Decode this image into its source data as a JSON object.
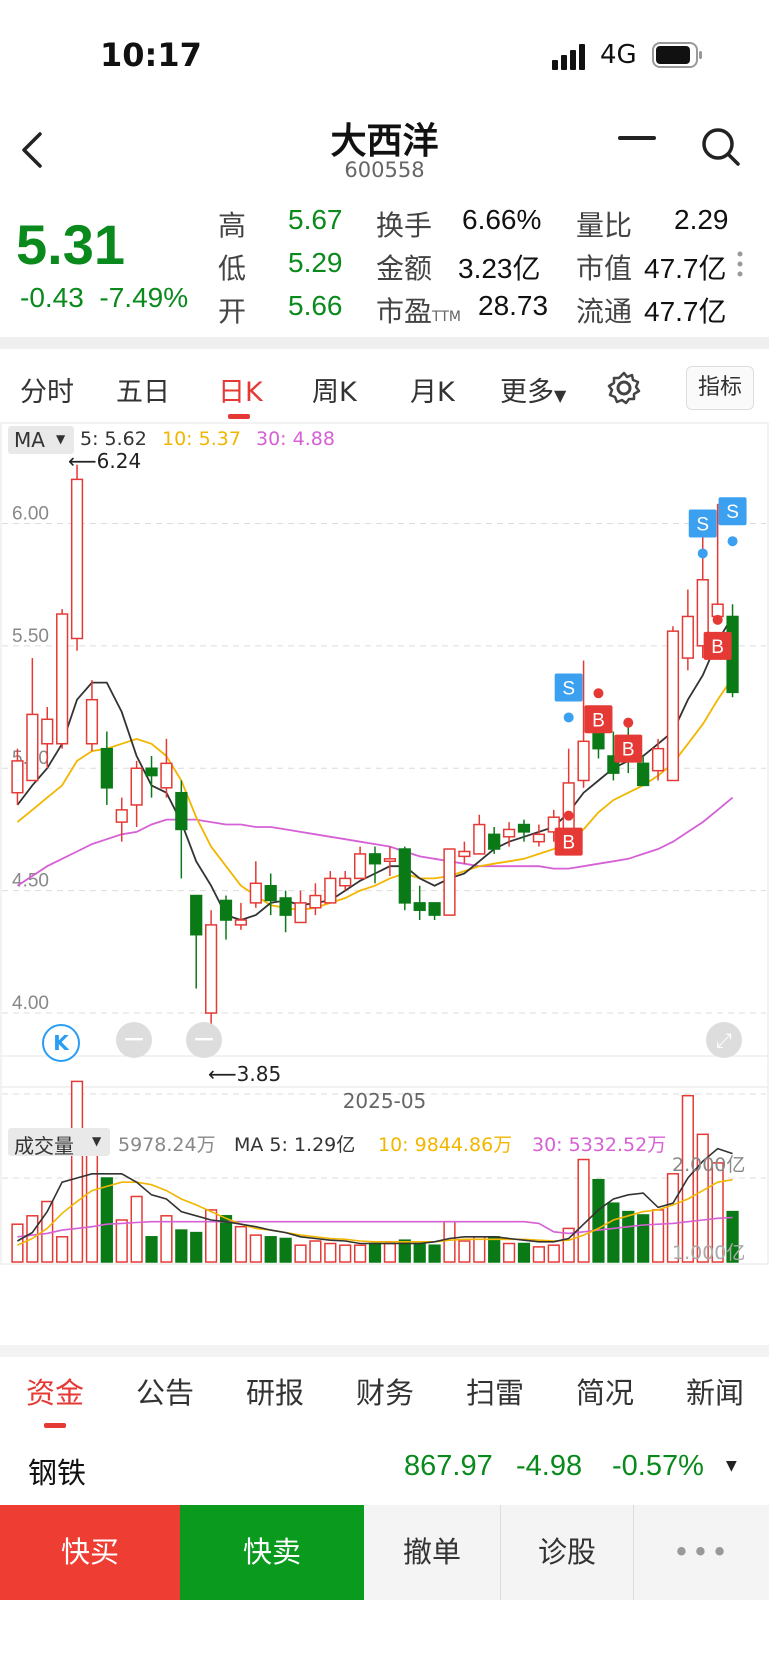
{
  "status_bar": {
    "time": "10:17",
    "network": "4G"
  },
  "header": {
    "title": "大西洋",
    "code": "600558"
  },
  "quote": {
    "price": "5.31",
    "change": "-0.43",
    "change_pct": "-7.49%",
    "high_label": "高",
    "high": "5.67",
    "low_label": "低",
    "low": "5.29",
    "open_label": "开",
    "open": "5.66",
    "turnover_label": "换手",
    "turnover": "6.66%",
    "amount_label": "金额",
    "amount": "3.23亿",
    "pe_label": "市盈",
    "pe_sub": "TTM",
    "pe": "28.73",
    "vol_ratio_label": "量比",
    "vol_ratio": "2.29",
    "mkt_cap_label": "市值",
    "mkt_cap": "47.7亿",
    "float_cap_label": "流通",
    "float_cap": "47.7亿"
  },
  "period_tabs": [
    "分时",
    "五日",
    "日K",
    "周K",
    "月K",
    "更多"
  ],
  "active_period": "日K",
  "indicator_button": "指标",
  "colors": {
    "up": "#e53935",
    "down": "#0a7a17",
    "ma5": "#333333",
    "ma10": "#f2b600",
    "ma30": "#d660d6",
    "sell_marker": "#3ba0f0",
    "buy_marker": "#e53935"
  },
  "chart_data": {
    "type": "candlestick",
    "ylim": [
      3.8,
      6.3
    ],
    "yticks": [
      "6.00",
      "5.50",
      "5.00",
      "4.50",
      "4.00"
    ],
    "ma_label": "MA",
    "ma5_label": "5: 5.62",
    "ma10_label": "10: 5.37",
    "ma30_label": "30: 4.88",
    "max_label": "6.24",
    "min_label": "3.85",
    "date_label": "2025-05",
    "candles": [
      [
        4.9,
        5.03,
        4.85,
        5.08
      ],
      [
        4.95,
        5.22,
        4.95,
        5.45
      ],
      [
        5.1,
        5.2,
        5.0,
        5.25
      ],
      [
        5.1,
        5.63,
        5.08,
        5.65
      ],
      [
        5.53,
        6.18,
        5.48,
        6.24
      ],
      [
        5.1,
        5.28,
        5.07,
        5.36
      ],
      [
        5.08,
        4.92,
        4.85,
        5.15
      ],
      [
        4.78,
        4.83,
        4.7,
        4.88
      ],
      [
        4.85,
        5.0,
        4.76,
        5.03
      ],
      [
        5.0,
        4.97,
        4.88,
        5.05
      ],
      [
        4.92,
        5.02,
        4.88,
        5.12
      ],
      [
        4.9,
        4.75,
        4.55,
        4.95
      ],
      [
        4.48,
        4.32,
        4.1,
        4.48
      ],
      [
        4.0,
        4.36,
        3.85,
        4.42
      ],
      [
        4.46,
        4.38,
        4.3,
        4.48
      ],
      [
        4.36,
        4.38,
        4.34,
        4.45
      ],
      [
        4.45,
        4.53,
        4.43,
        4.62
      ],
      [
        4.52,
        4.46,
        4.4,
        4.57
      ],
      [
        4.47,
        4.4,
        4.33,
        4.5
      ],
      [
        4.37,
        4.45,
        4.37,
        4.5
      ],
      [
        4.43,
        4.48,
        4.4,
        4.53
      ],
      [
        4.45,
        4.55,
        4.45,
        4.58
      ],
      [
        4.52,
        4.55,
        4.5,
        4.58
      ],
      [
        4.55,
        4.65,
        4.55,
        4.68
      ],
      [
        4.65,
        4.61,
        4.53,
        4.68
      ],
      [
        4.62,
        4.63,
        4.56,
        4.68
      ],
      [
        4.67,
        4.45,
        4.42,
        4.68
      ],
      [
        4.45,
        4.42,
        4.38,
        4.52
      ],
      [
        4.45,
        4.4,
        4.38,
        4.45
      ],
      [
        4.4,
        4.67,
        4.4,
        4.67
      ],
      [
        4.64,
        4.66,
        4.61,
        4.7
      ],
      [
        4.65,
        4.77,
        4.65,
        4.81
      ],
      [
        4.73,
        4.67,
        4.65,
        4.76
      ],
      [
        4.72,
        4.75,
        4.68,
        4.78
      ],
      [
        4.77,
        4.74,
        4.7,
        4.79
      ],
      [
        4.7,
        4.73,
        4.68,
        4.77
      ],
      [
        4.74,
        4.8,
        4.7,
        4.83
      ],
      [
        4.75,
        4.94,
        4.73,
        5.08
      ],
      [
        4.95,
        5.11,
        4.92,
        5.44
      ],
      [
        5.15,
        5.08,
        5.04,
        5.25
      ],
      [
        5.05,
        4.98,
        4.95,
        5.15
      ],
      [
        5.11,
        5.03,
        4.98,
        5.2
      ],
      [
        5.02,
        4.93,
        4.93,
        5.05
      ],
      [
        4.99,
        5.08,
        4.95,
        5.12
      ],
      [
        4.95,
        5.56,
        4.95,
        5.58
      ],
      [
        5.45,
        5.62,
        5.4,
        5.73
      ],
      [
        5.5,
        5.77,
        5.45,
        5.95
      ],
      [
        5.62,
        5.67,
        5.6,
        6.08
      ],
      [
        5.62,
        5.31,
        5.29,
        5.67
      ]
    ],
    "ma5": [
      4.85,
      4.93,
      5.0,
      5.1,
      5.28,
      5.35,
      5.35,
      5.23,
      5.05,
      4.93,
      4.9,
      4.78,
      4.62,
      4.52,
      4.4,
      4.38,
      4.4,
      4.45,
      4.46,
      4.44,
      4.45,
      4.46,
      4.5,
      4.54,
      4.57,
      4.6,
      4.6,
      4.55,
      4.52,
      4.55,
      4.57,
      4.62,
      4.67,
      4.7,
      4.72,
      4.74,
      4.76,
      4.82,
      4.9,
      4.95,
      5.0,
      5.03,
      5.05,
      5.1,
      5.15,
      5.28,
      5.38,
      5.52,
      5.62
    ],
    "ma10": [
      4.78,
      4.83,
      4.88,
      4.93,
      5.03,
      5.07,
      5.08,
      5.1,
      5.12,
      5.1,
      5.05,
      4.95,
      4.8,
      4.68,
      4.6,
      4.52,
      4.48,
      4.44,
      4.43,
      4.42,
      4.43,
      4.45,
      4.47,
      4.5,
      4.52,
      4.55,
      4.57,
      4.55,
      4.55,
      4.56,
      4.58,
      4.6,
      4.61,
      4.62,
      4.63,
      4.65,
      4.67,
      4.7,
      4.75,
      4.82,
      4.87,
      4.9,
      4.93,
      4.97,
      5.02,
      5.1,
      5.18,
      5.28,
      5.37
    ],
    "ma30": [
      4.52,
      4.56,
      4.6,
      4.63,
      4.66,
      4.69,
      4.71,
      4.73,
      4.74,
      4.77,
      4.79,
      4.79,
      4.79,
      4.78,
      4.77,
      4.77,
      4.76,
      4.76,
      4.75,
      4.74,
      4.73,
      4.72,
      4.71,
      4.7,
      4.69,
      4.68,
      4.66,
      4.64,
      4.63,
      4.62,
      4.61,
      4.6,
      4.6,
      4.6,
      4.6,
      4.6,
      4.59,
      4.59,
      4.6,
      4.61,
      4.62,
      4.63,
      4.65,
      4.67,
      4.7,
      4.74,
      4.78,
      4.83,
      4.88
    ],
    "signals": [
      {
        "i": 37,
        "type": "B",
        "price": 4.7,
        "label": "B"
      },
      {
        "i": 37,
        "type": "S",
        "price": 5.33,
        "label": "S"
      },
      {
        "i": 39,
        "type": "B",
        "price": 5.2,
        "label": "B"
      },
      {
        "i": 41,
        "type": "B",
        "price": 5.08,
        "label": "B"
      },
      {
        "i": 46,
        "type": "S",
        "price": 6.0,
        "label": "S"
      },
      {
        "i": 47,
        "type": "B",
        "price": 5.5,
        "label": "B"
      },
      {
        "i": 48,
        "type": "S",
        "price": 6.05,
        "label": "S"
      }
    ],
    "volume": {
      "label": "成交量",
      "last_label": "5978.24万",
      "ma5_label": "MA 5: 1.29亿",
      "ma10_label": "10: 9844.86万",
      "ma30_label": "30: 5332.52万",
      "tick_top": "2.000亿",
      "tick_mid": "1.000亿",
      "ymax": 2.0,
      "values": [
        0.45,
        0.55,
        0.72,
        0.3,
        2.15,
        1.55,
        1.0,
        0.5,
        0.78,
        0.3,
        0.55,
        0.38,
        0.35,
        0.62,
        0.55,
        0.42,
        0.32,
        0.3,
        0.28,
        0.2,
        0.25,
        0.22,
        0.2,
        0.2,
        0.22,
        0.22,
        0.26,
        0.22,
        0.2,
        0.48,
        0.25,
        0.3,
        0.3,
        0.22,
        0.22,
        0.18,
        0.2,
        0.4,
        1.22,
        0.98,
        0.7,
        0.6,
        0.56,
        0.62,
        1.05,
        1.98,
        1.52,
        1.18,
        0.6
      ],
      "ma5": [
        0.25,
        0.35,
        0.6,
        0.95,
        1.0,
        1.05,
        1.05,
        1.05,
        0.95,
        0.8,
        0.75,
        0.6,
        0.55,
        0.5,
        0.48,
        0.45,
        0.42,
        0.38,
        0.35,
        0.3,
        0.28,
        0.26,
        0.25,
        0.22,
        0.22,
        0.22,
        0.22,
        0.22,
        0.24,
        0.28,
        0.3,
        0.3,
        0.3,
        0.28,
        0.26,
        0.24,
        0.24,
        0.28,
        0.45,
        0.62,
        0.75,
        0.8,
        0.82,
        0.65,
        0.7,
        1.0,
        1.2,
        1.35,
        1.29
      ],
      "ma10": [
        0.2,
        0.28,
        0.4,
        0.58,
        0.72,
        0.85,
        0.9,
        0.95,
        0.95,
        0.92,
        0.85,
        0.75,
        0.68,
        0.6,
        0.52,
        0.45,
        0.4,
        0.38,
        0.35,
        0.32,
        0.3,
        0.28,
        0.27,
        0.25,
        0.24,
        0.24,
        0.24,
        0.24,
        0.24,
        0.26,
        0.27,
        0.27,
        0.27,
        0.27,
        0.27,
        0.26,
        0.25,
        0.26,
        0.32,
        0.4,
        0.5,
        0.55,
        0.6,
        0.62,
        0.68,
        0.75,
        0.85,
        0.95,
        0.98
      ],
      "ma30": [
        0.3,
        0.32,
        0.34,
        0.38,
        0.4,
        0.42,
        0.45,
        0.46,
        0.47,
        0.48,
        0.48,
        0.48,
        0.48,
        0.48,
        0.48,
        0.48,
        0.48,
        0.48,
        0.48,
        0.48,
        0.48,
        0.48,
        0.48,
        0.48,
        0.48,
        0.48,
        0.48,
        0.48,
        0.48,
        0.48,
        0.48,
        0.48,
        0.48,
        0.48,
        0.48,
        0.46,
        0.36,
        0.34,
        0.36,
        0.38,
        0.4,
        0.42,
        0.44,
        0.45,
        0.46,
        0.48,
        0.5,
        0.52,
        0.53
      ]
    }
  },
  "bottom_tabs": [
    "资金",
    "公告",
    "研报",
    "财务",
    "扫雷",
    "简况",
    "新闻"
  ],
  "active_bottom_tab": "资金",
  "industry": {
    "name": "钢铁",
    "value": "867.97",
    "change": "-4.98",
    "change_pct": "-0.57%"
  },
  "actions": {
    "quick_buy": "快买",
    "quick_sell": "快卖",
    "cancel": "撤单",
    "diagnose": "诊股",
    "more": "•••"
  }
}
